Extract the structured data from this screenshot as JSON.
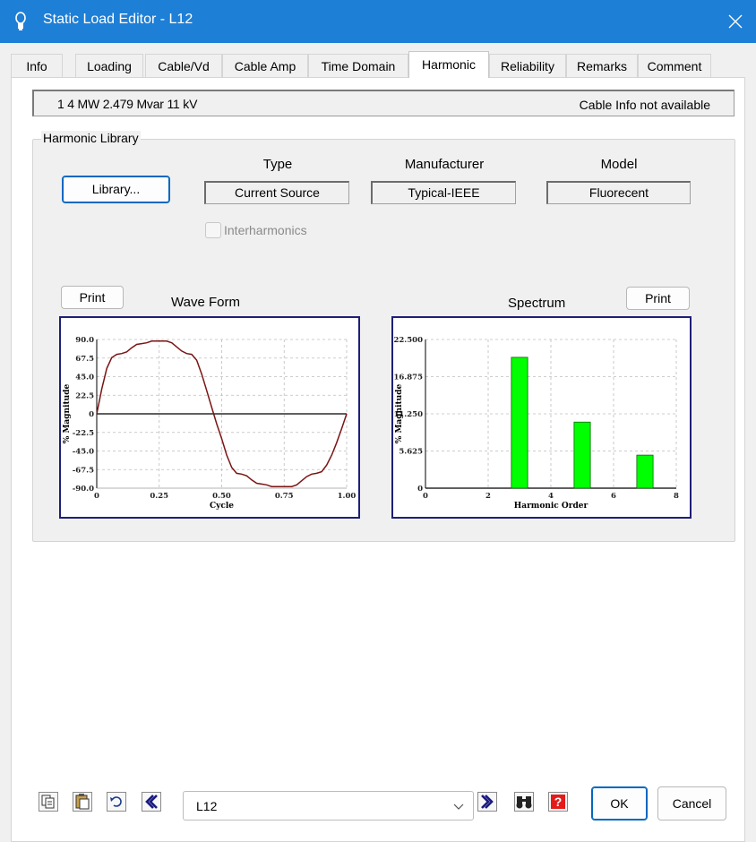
{
  "window": {
    "title": "Static Load Editor - L12"
  },
  "tabs": [
    {
      "label": "Info"
    },
    {
      "label": "Loading"
    },
    {
      "label": "Cable/Vd"
    },
    {
      "label": "Cable Amp"
    },
    {
      "label": "Time Domain"
    },
    {
      "label": "Harmonic",
      "active": true
    },
    {
      "label": "Reliability"
    },
    {
      "label": "Remarks"
    },
    {
      "label": "Comment"
    }
  ],
  "info_bar": {
    "summary": "1  4 MW  2.479 Mvar  11 kV",
    "cable_info": "Cable Info not available"
  },
  "harmonic_library": {
    "group_label": "Harmonic Library",
    "library_button": "Library...",
    "type_header": "Type",
    "type_value": "Current Source",
    "manufacturer_header": "Manufacturer",
    "manufacturer_value": "Typical-IEEE",
    "model_header": "Model",
    "model_value": "Fluorecent",
    "interharmonics_label": "Interharmonics",
    "interharmonics_checked": false
  },
  "waveform": {
    "title": "Wave Form",
    "print_label": "Print"
  },
  "spectrum": {
    "title": "Spectrum",
    "print_label": "Print"
  },
  "chart_data": [
    {
      "type": "line",
      "title": "Wave Form",
      "xlabel": "Cycle",
      "ylabel": "% Magnitude",
      "xlim": [
        0,
        1
      ],
      "ylim": [
        -90,
        90
      ],
      "x_ticks": [
        "0",
        "0.25",
        "0.50",
        "0.75",
        "1.00"
      ],
      "y_ticks": [
        "90.0",
        "67.5",
        "45.0",
        "22.5",
        "0",
        "-22.5",
        "-45.0",
        "-67.5",
        "-90.0"
      ],
      "grid": true,
      "color": "#7a1414",
      "x": [
        0,
        0.02,
        0.04,
        0.06,
        0.08,
        0.1,
        0.12,
        0.14,
        0.16,
        0.18,
        0.2,
        0.22,
        0.25,
        0.28,
        0.3,
        0.32,
        0.34,
        0.36,
        0.38,
        0.4,
        0.42,
        0.44,
        0.46,
        0.48,
        0.5,
        0.52,
        0.54,
        0.56,
        0.58,
        0.6,
        0.62,
        0.64,
        0.66,
        0.68,
        0.7,
        0.72,
        0.75,
        0.78,
        0.8,
        0.82,
        0.84,
        0.86,
        0.88,
        0.9,
        0.92,
        0.94,
        0.96,
        0.98,
        1.0
      ],
      "y": [
        0,
        30,
        55,
        68,
        72,
        73,
        75,
        80,
        84,
        85,
        86,
        88,
        88,
        88,
        86,
        81,
        76,
        73,
        72,
        65,
        48,
        28,
        8,
        -12,
        -30,
        -50,
        -65,
        -72,
        -73,
        -75,
        -80,
        -84,
        -85,
        -86,
        -88,
        -88,
        -88,
        -88,
        -86,
        -81,
        -76,
        -73,
        -72,
        -70,
        -62,
        -50,
        -35,
        -18,
        0
      ]
    },
    {
      "type": "bar",
      "title": "Spectrum",
      "xlabel": "Harmonic Order",
      "ylabel": "% Magnitude",
      "xlim": [
        0,
        8
      ],
      "ylim": [
        0,
        22.5
      ],
      "x_ticks": [
        "0",
        "2",
        "4",
        "6",
        "8"
      ],
      "y_ticks": [
        "22.500",
        "16.875",
        "11.250",
        "5.625",
        "0"
      ],
      "grid": true,
      "color": "#00ff00",
      "categories": [
        3,
        5,
        7
      ],
      "values": [
        19.8,
        10.0,
        5.0
      ]
    }
  ],
  "bottom_bar": {
    "load_id": "L12",
    "ok_label": "OK",
    "cancel_label": "Cancel"
  }
}
